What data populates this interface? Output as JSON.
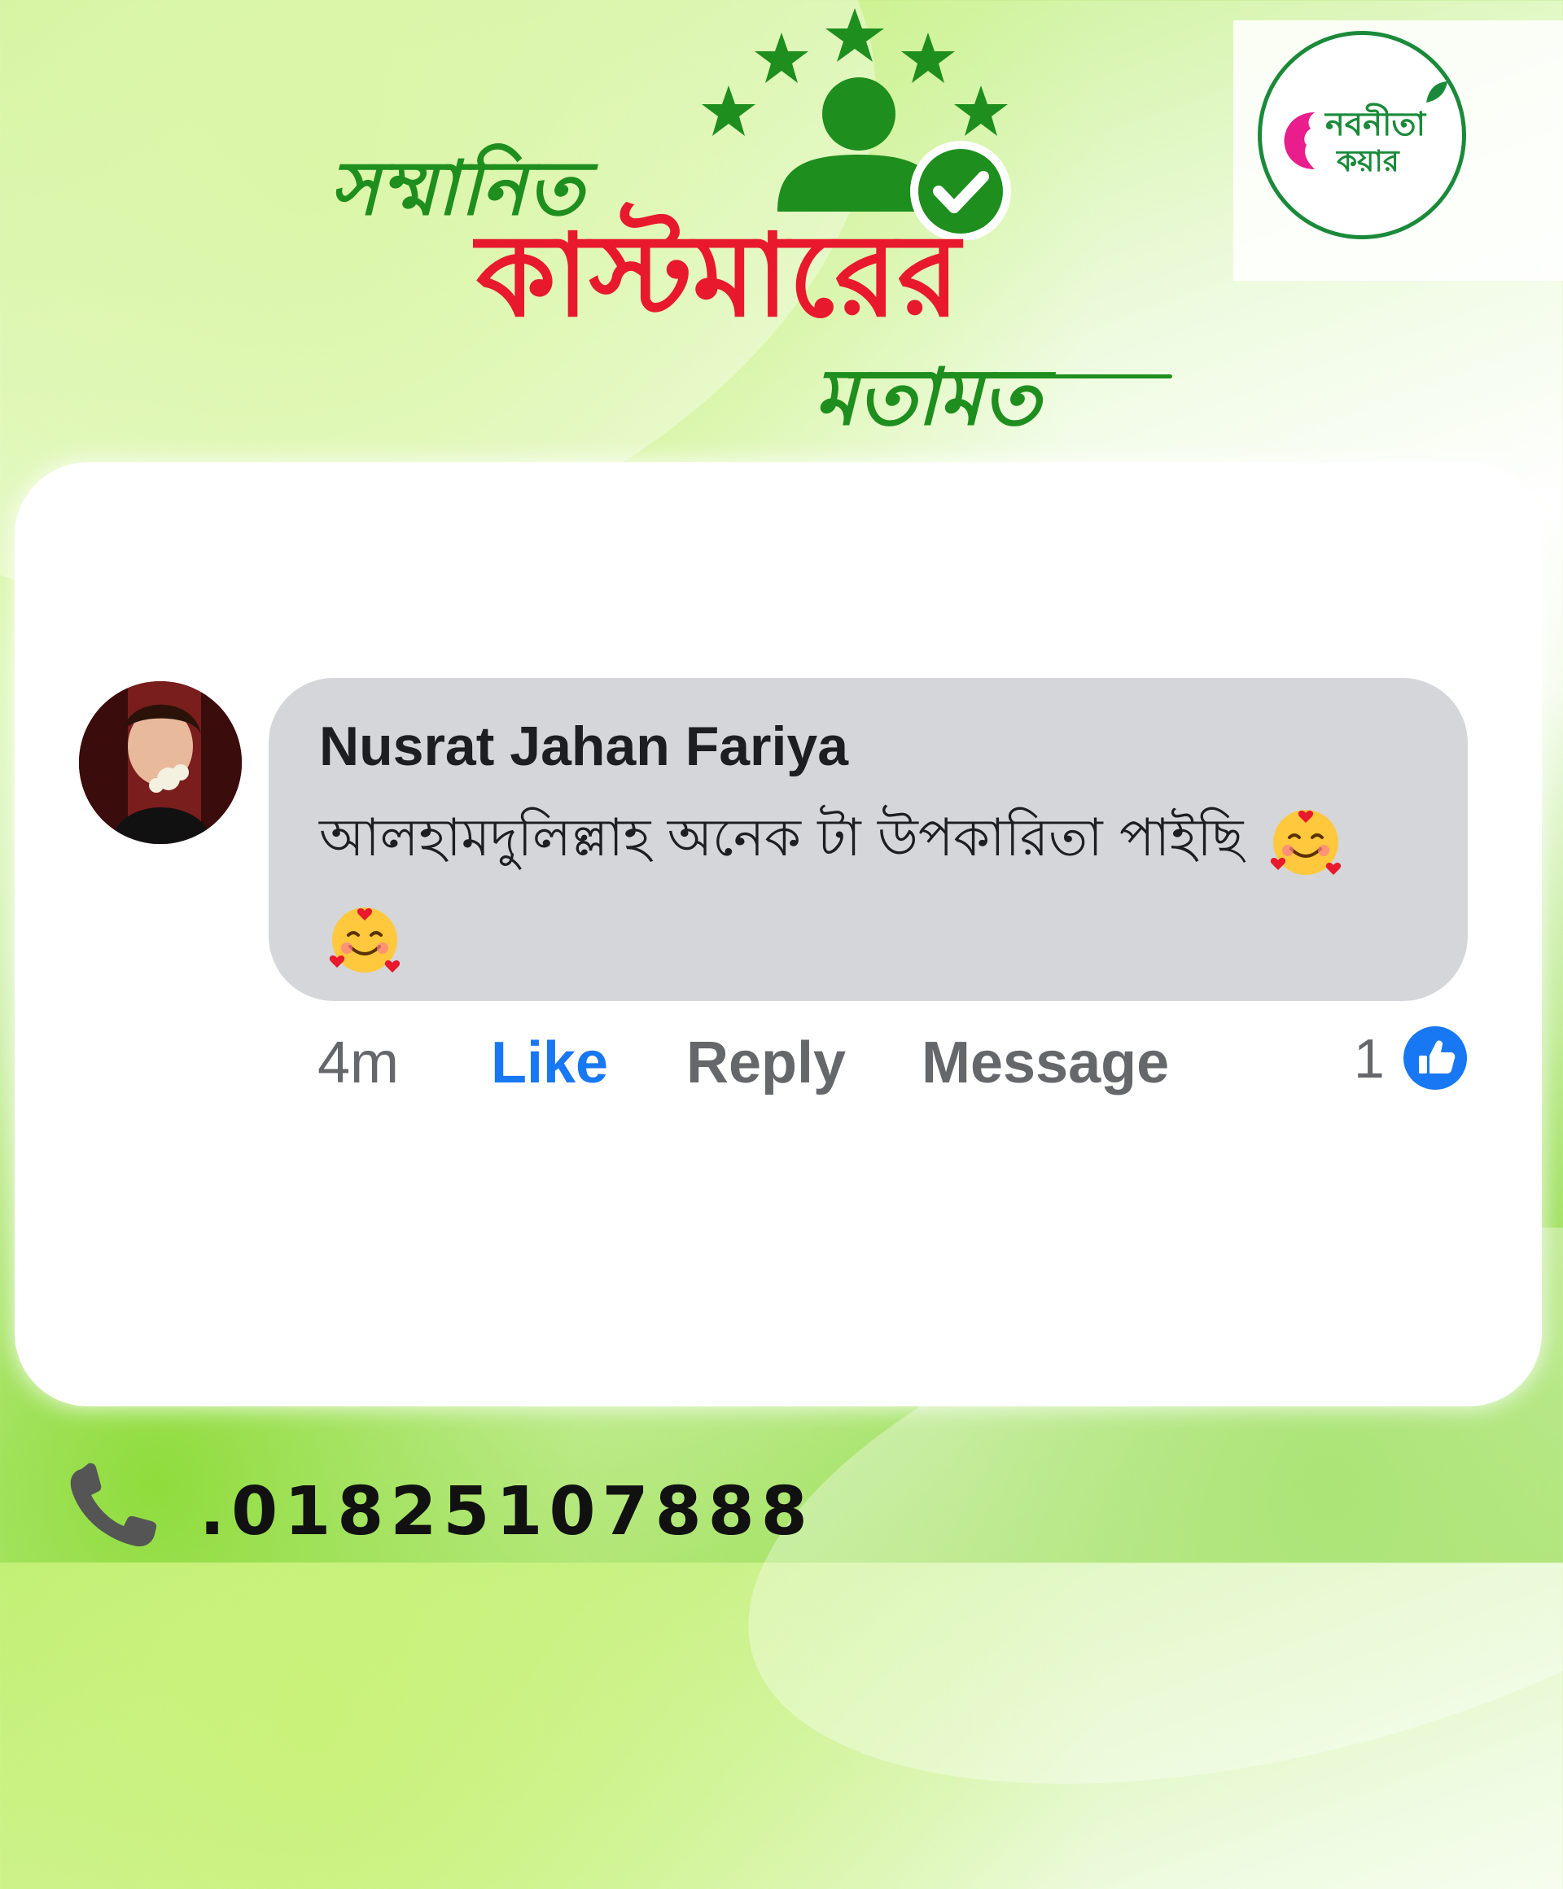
{
  "header": {
    "title_line1": "সম্মানিত",
    "title_line2": "কাস্টমারের",
    "title_line3": "মতামত",
    "star_count": 5
  },
  "brand": {
    "line1": "নবনীতা",
    "line2": "কয়ার",
    "color": "#1a8a3a",
    "accent": "#e91e8c"
  },
  "comment": {
    "author": "Nusrat Jahan Fariya",
    "text": "আলহামদুলিল্লাহ  অনেক  টা উপকারিতা পাইছি",
    "emojis": [
      "smiling-face-with-hearts",
      "smiling-face-with-hearts"
    ],
    "time": "4m",
    "actions": {
      "like": "Like",
      "reply": "Reply",
      "message": "Message"
    },
    "reaction_count": "1",
    "reaction_icon": "thumbs-up-icon"
  },
  "footer": {
    "phone": ".01825107888",
    "phone_icon": "phone-icon"
  },
  "colors": {
    "green": "#1e8e1e",
    "red": "#e8192c",
    "facebook_blue": "#1877f2",
    "bubble": "#d4d6da"
  }
}
